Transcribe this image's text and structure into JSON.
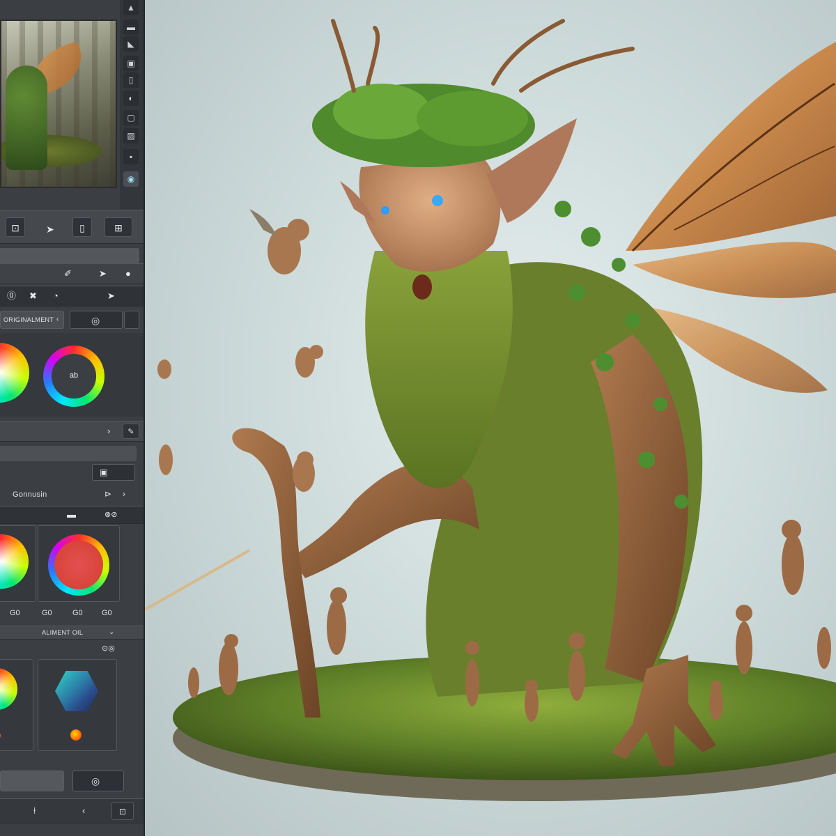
{
  "panel": {
    "dropdown_label": "ORIGINALMENT",
    "wheel_label": "ab",
    "section_label": "Gonnusin",
    "tool_label": "ALIMENT OIL",
    "values": [
      "G0",
      "G0",
      "G0",
      "G0"
    ],
    "accent_color": "#2fd6c9",
    "panel_bg": "#3b3e43"
  },
  "icons": {
    "rail": [
      "arrow-up-icon",
      "triangle-icon",
      "image-icon",
      "layers-icon",
      "eye-icon",
      "circle-icon"
    ],
    "toolbar": [
      "select-icon",
      "move-icon",
      "frame-icon",
      "grid-icon"
    ]
  }
}
